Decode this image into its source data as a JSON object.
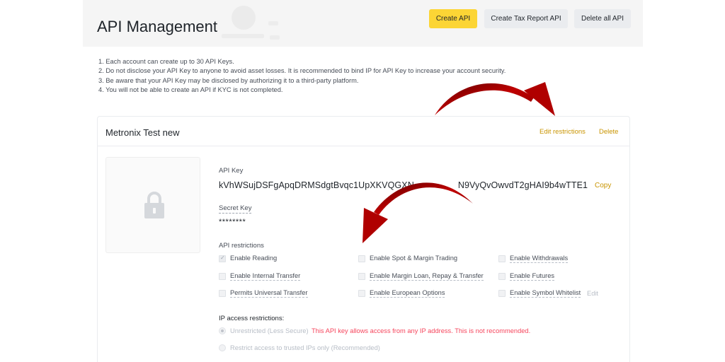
{
  "header": {
    "title": "API Management",
    "buttons": {
      "create": "Create API",
      "tax_report": "Create Tax Report API",
      "delete_all": "Delete all API"
    }
  },
  "notes": [
    "1. Each account can create up to 30 API Keys.",
    "2. Do not disclose your API Key to anyone to avoid asset losses. It is recommended to bind IP for API Key to increase your account security.",
    "3. Be aware that your API Key may be disclosed by authorizing it to a third-party platform.",
    "4. You will not be able to create an API if KYC is not completed."
  ],
  "card": {
    "title": "Metronix Test new",
    "edit_label": "Edit restrictions",
    "delete_label": "Delete",
    "api_key_label": "API Key",
    "api_key_value_left": "kVhWSujDSFgApqDRMSdgtBvqc1UpXKVQGXN",
    "api_key_value_right": "N9VyQvOwvdT2gHAI9b4wTTE1",
    "copy_label": "Copy",
    "secret_key_label": "Secret Key",
    "secret_key_value": "********",
    "restrictions_label": "API restrictions",
    "options": {
      "enable_reading": "Enable Reading",
      "enable_spot_margin": "Enable Spot & Margin Trading",
      "enable_withdrawals": "Enable Withdrawals",
      "enable_internal_transfer": "Enable Internal Transfer",
      "enable_margin_loan": "Enable Margin Loan, Repay & Transfer",
      "enable_futures": "Enable Futures",
      "permits_universal_transfer": "Permits Universal Transfer",
      "enable_european_options": "Enable European Options",
      "enable_symbol_whitelist": "Enable Symbol Whitelist"
    },
    "whitelist_edit": "Edit",
    "ip_label": "IP access restrictions:",
    "ip_unrestricted": "Unrestricted (Less Secure)",
    "ip_warning": "This API key allows access from any IP address. This is not recommended.",
    "ip_restricted": "Restrict access to trusted IPs only (Recommended)"
  },
  "colors": {
    "accent_yellow": "#fcd535",
    "link_gold": "#c99400",
    "warning_red": "#f6465d",
    "arrow_red": "#b00000"
  }
}
